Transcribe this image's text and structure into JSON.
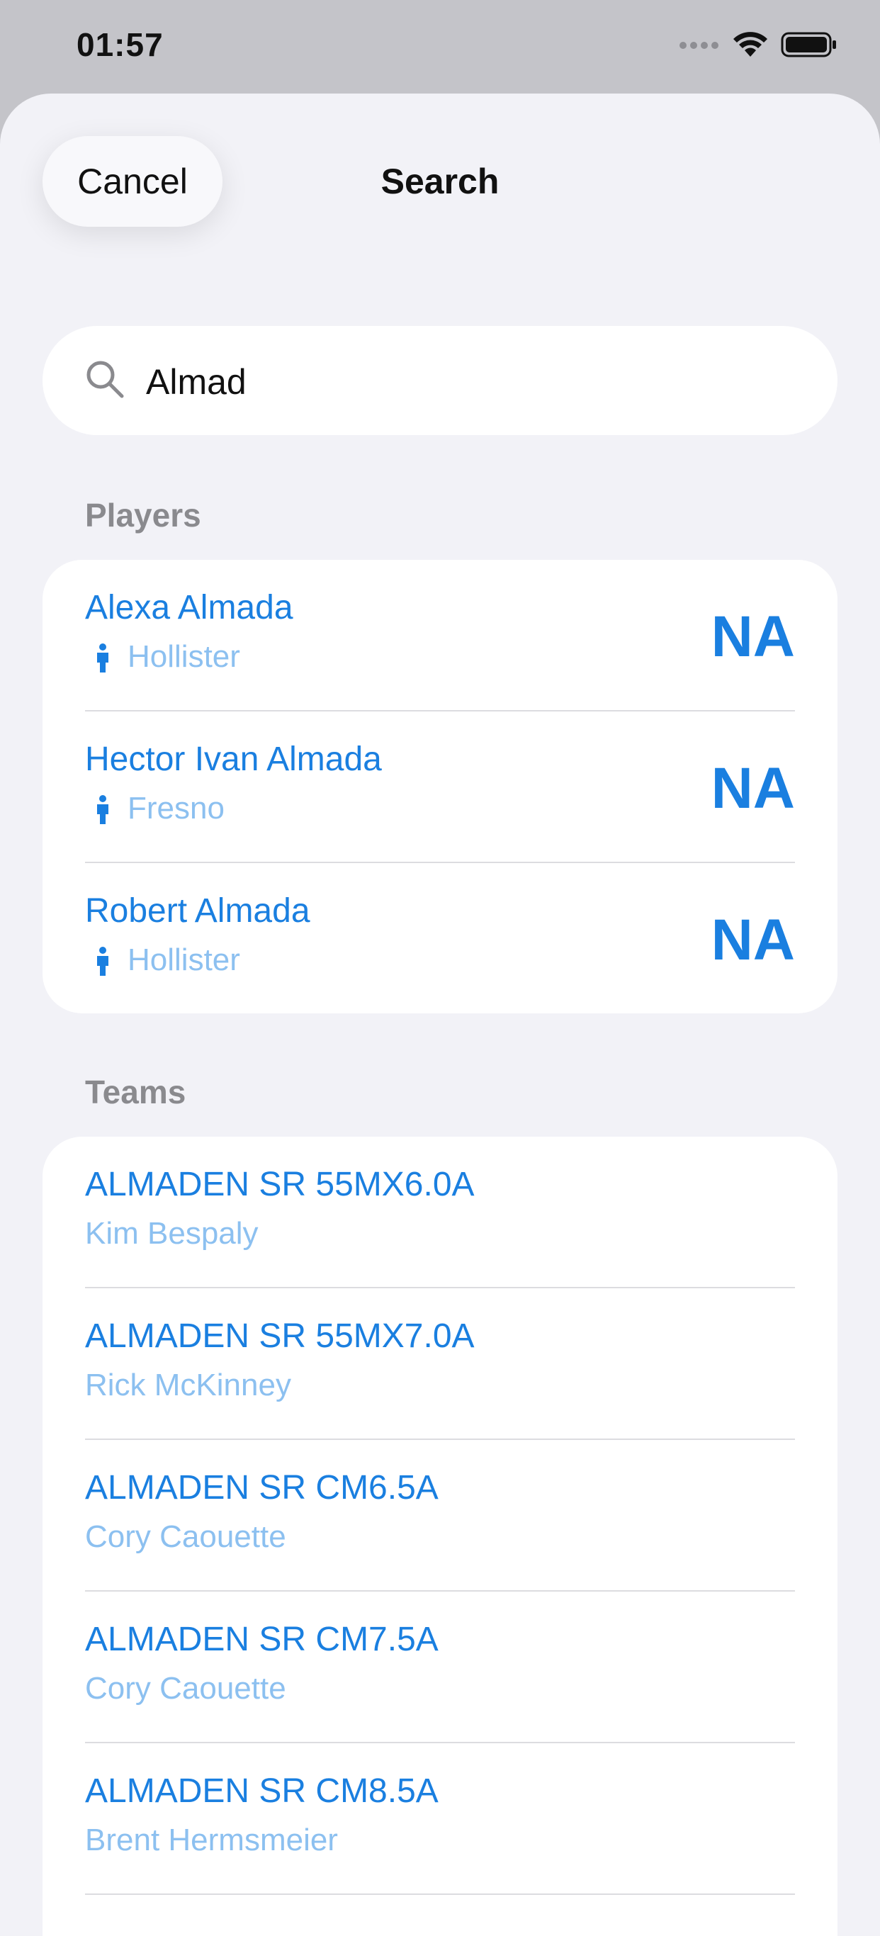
{
  "status_bar": {
    "time": "01:57",
    "icons": [
      "signal-dots-icon",
      "wifi-icon",
      "battery-icon"
    ]
  },
  "header": {
    "cancel_label": "Cancel",
    "title": "Search"
  },
  "search": {
    "value": "Almad",
    "icon": "search-icon"
  },
  "players": {
    "section_label": "Players",
    "items": [
      {
        "name": "Alexa Almada",
        "location": "Hollister",
        "rating": "NA"
      },
      {
        "name": "Hector Ivan Almada",
        "location": "Fresno",
        "rating": "NA"
      },
      {
        "name": "Robert Almada",
        "location": "Hollister",
        "rating": "NA"
      }
    ]
  },
  "teams": {
    "section_label": "Teams",
    "items": [
      {
        "name": "ALMADEN SR 55MX6.0A",
        "captain": "Kim Bespaly"
      },
      {
        "name": "ALMADEN SR 55MX7.0A",
        "captain": "Rick McKinney"
      },
      {
        "name": "ALMADEN SR CM6.5A",
        "captain": "Cory Caouette"
      },
      {
        "name": "ALMADEN SR CM7.5A",
        "captain": "Cory Caouette"
      },
      {
        "name": "ALMADEN SR CM8.5A",
        "captain": "Brent Hermsmeier"
      }
    ]
  },
  "colors": {
    "accent": "#1a7fe0",
    "accent_light": "#8cc0f0",
    "background": "#f2f2f7",
    "secondary_text": "#8a8a8e"
  }
}
